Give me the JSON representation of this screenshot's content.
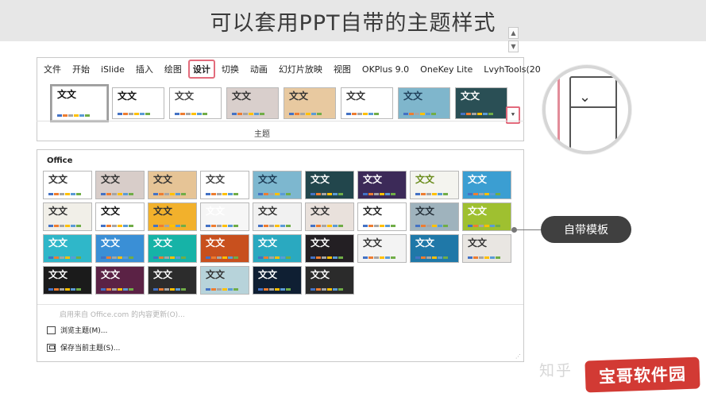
{
  "banner": {
    "title": "可以套用PPT自带的主题样式"
  },
  "ribbon": {
    "tabs": [
      {
        "label": "文件",
        "active": false
      },
      {
        "label": "开始",
        "active": false
      },
      {
        "label": "iSlide",
        "active": false
      },
      {
        "label": "插入",
        "active": false
      },
      {
        "label": "绘图",
        "active": false
      },
      {
        "label": "设计",
        "active": true
      },
      {
        "label": "切换",
        "active": false
      },
      {
        "label": "动画",
        "active": false
      },
      {
        "label": "幻灯片放映",
        "active": false
      },
      {
        "label": "视图",
        "active": false
      },
      {
        "label": "OKPlus 9.0",
        "active": false
      },
      {
        "label": "OneKey Lite",
        "active": false
      },
      {
        "label": "LvyhTools(20",
        "active": false
      }
    ],
    "group_label": "主题",
    "thumbs": [
      {
        "text": "文文",
        "bg": "#ffffff",
        "fg": "#111111",
        "style": "bold"
      },
      {
        "text": "文文",
        "bg": "#ffffff",
        "fg": "#111111",
        "style": "bold"
      },
      {
        "text": "文文",
        "bg": "#ffffff",
        "fg": "#444444",
        "style": "plain"
      },
      {
        "text": "文文",
        "bg": "#d9cfcc",
        "fg": "#333333",
        "style": "grey"
      },
      {
        "text": "文文",
        "bg": "#e8c9a0",
        "fg": "#333333",
        "style": "wood"
      },
      {
        "text": "文文",
        "bg": "#ffffff",
        "fg": "#333333",
        "style": "plain"
      },
      {
        "text": "文文",
        "bg": "#7fb6cc",
        "fg": "#1f3f5a",
        "style": "pattern"
      },
      {
        "text": "文文",
        "bg": "#2a4f55",
        "fg": "#ffffff",
        "style": "dark"
      }
    ]
  },
  "zoom": {
    "icon": "chevron-down-icon"
  },
  "gallery": {
    "heading": "Office",
    "thumbs": [
      {
        "text": "文文",
        "bg": "#ffffff",
        "fg": "#333"
      },
      {
        "text": "文文",
        "bg": "#d8cdc9",
        "fg": "#333"
      },
      {
        "text": "文文",
        "bg": "#e6c496",
        "fg": "#333"
      },
      {
        "text": "文文",
        "bg": "#ffffff",
        "fg": "#444"
      },
      {
        "text": "文文",
        "bg": "#7db7cf",
        "fg": "#1d3c56"
      },
      {
        "text": "文文",
        "bg": "#22464c",
        "fg": "#ffffff"
      },
      {
        "text": "文文",
        "bg": "#3c2a58",
        "fg": "#ffffff"
      },
      {
        "text": "文文",
        "bg": "#f4f4ef",
        "fg": "#6a8c1d"
      },
      {
        "text": "文文",
        "bg": "#3b9ed2",
        "fg": "#ffffff"
      },
      {
        "text": "文文",
        "bg": "#f1efe8",
        "fg": "#333"
      },
      {
        "text": "文文",
        "bg": "#ffffff",
        "fg": "#111"
      },
      {
        "text": "文文",
        "bg": "#f2b12c",
        "fg": "#333"
      },
      {
        "text": "文文",
        "bg": "#f6f6f6",
        "fg": "#ffffff"
      },
      {
        "text": "文文",
        "bg": "#f1f1f1",
        "fg": "#333"
      },
      {
        "text": "文文",
        "bg": "#e9e1dc",
        "fg": "#333"
      },
      {
        "text": "文文",
        "bg": "#ffffff",
        "fg": "#222"
      },
      {
        "text": "文文",
        "bg": "#9fb3bd",
        "fg": "#26313a"
      },
      {
        "text": "文文",
        "bg": "#9fc030",
        "fg": "#ffffff"
      },
      {
        "text": "文文",
        "bg": "#2fb7c9",
        "fg": "#ffffff"
      },
      {
        "text": "文文",
        "bg": "#3a8fd6",
        "fg": "#ffffff"
      },
      {
        "text": "文文",
        "bg": "#16b3a7",
        "fg": "#ffffff"
      },
      {
        "text": "文文",
        "bg": "#c8501e",
        "fg": "#ffffff"
      },
      {
        "text": "文文",
        "bg": "#2aa9c0",
        "fg": "#ffffff"
      },
      {
        "text": "文文",
        "bg": "#231f23",
        "fg": "#ffffff"
      },
      {
        "text": "文文",
        "bg": "#f3f3f3",
        "fg": "#333"
      },
      {
        "text": "文文",
        "bg": "#1f78a8",
        "fg": "#ffffff"
      },
      {
        "text": "文文",
        "bg": "#e9e6e2",
        "fg": "#333"
      },
      {
        "text": "文文",
        "bg": "#1b1b1b",
        "fg": "#ffffff"
      },
      {
        "text": "文文",
        "bg": "#5b2245",
        "fg": "#ffffff"
      },
      {
        "text": "文文",
        "bg": "#2c2c2c",
        "fg": "#ffffff"
      },
      {
        "text": "文文",
        "bg": "#b7d3da",
        "fg": "#333"
      },
      {
        "text": "文文",
        "bg": "#0f1f33",
        "fg": "#ffffff"
      },
      {
        "text": "文文",
        "bg": "#2b2b2b",
        "fg": "#ffffff"
      }
    ],
    "disabled_item": "启用来自 Office.com 的内容更新(O)...",
    "browse_item": "浏览主题(M)...",
    "save_item": "保存当前主题(S)..."
  },
  "callout": {
    "label": "自带模板"
  },
  "watermark": {
    "zhihu": "知乎",
    "badge": "宝哥软件园"
  }
}
